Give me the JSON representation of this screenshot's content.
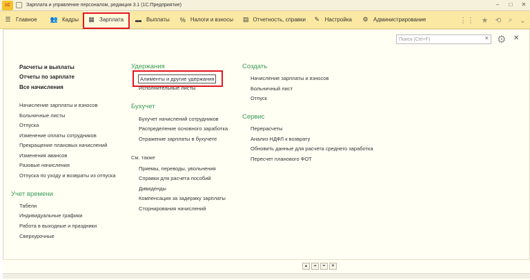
{
  "window": {
    "title": "Зарплата и управление персоналом, редакция 3.1  (1С:Предприятие)",
    "logo_text": "1С"
  },
  "sections": [
    {
      "label": "Главное",
      "icon": "menu-icon"
    },
    {
      "label": "Кадры",
      "icon": "people-icon"
    },
    {
      "label": "Зарплата",
      "icon": "calculator-icon"
    },
    {
      "label": "Выплаты",
      "icon": "wallet-icon"
    },
    {
      "label": "Налоги и взносы",
      "icon": "percent-icon"
    },
    {
      "label": "Отчетность, справки",
      "icon": "reports-icon"
    },
    {
      "label": "Настройка",
      "icon": "wrench-icon"
    },
    {
      "label": "Администрирование",
      "icon": "gear-icon"
    }
  ],
  "search": {
    "placeholder": "Поиск (Ctrl+F)"
  },
  "col1": {
    "bold_links": [
      "Расчеты и выплаты",
      "Отчеты по зарплате",
      "Все начисления"
    ],
    "links": [
      "Начисление зарплаты и взносов",
      "Больничные листы",
      "Отпуска",
      "Изменение оплаты сотрудников",
      "Прекращение плановых начислений",
      "Изменения авансов",
      "Разовые начисления",
      "Отпуска по уходу и возвраты из отпуска"
    ],
    "time_heading": "Учет времени",
    "time_links": [
      "Табели",
      "Индивидуальные графики",
      "Работа в выходные и праздники",
      "Сверхурочные"
    ]
  },
  "col2": {
    "deductions_heading": "Удержания",
    "deductions_links": [
      "Алименты и другие удержания",
      "Исполнительные листы"
    ],
    "accounting_heading": "Бухучет",
    "accounting_links": [
      "Бухучет начислений сотрудников",
      "Распределение основного заработка",
      "Отражение зарплаты в бухучете"
    ],
    "see_also": "См. также",
    "see_also_links": [
      "Приемы, переводы, увольнения",
      "Справки для расчета пособий",
      "Дивиденды",
      "Компенсация за задержку зарплаты",
      "Сторнирования начислений"
    ]
  },
  "col3": {
    "create_heading": "Создать",
    "create_links": [
      "Начисление зарплаты и взносов",
      "Больничный лист",
      "Отпуск"
    ],
    "service_heading": "Сервис",
    "service_links": [
      "Перерасчеты",
      "Анализ НДФЛ к возврату",
      "Обновить данные для расчета среднего заработка",
      "Пересчет планового ФОТ"
    ]
  },
  "colors": {
    "accent_green": "#3a9a55",
    "highlight_red": "#e1141f",
    "section_bar": "#fbe9a3"
  }
}
